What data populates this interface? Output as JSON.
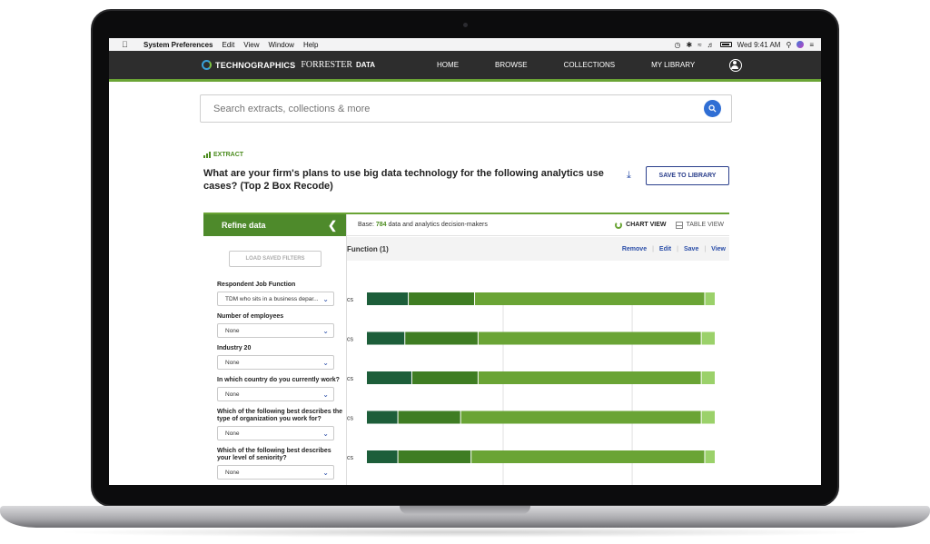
{
  "menubar": {
    "app_name": "System Preferences",
    "menus": [
      "Edit",
      "View",
      "Window",
      "Help"
    ],
    "clock": "Wed 9:41 AM"
  },
  "nav": {
    "logo_primary": "TECHNOGRAPHICS",
    "logo_secondary": "FORRESTER",
    "logo_suffix": "DATA",
    "links": [
      "HOME",
      "BROWSE",
      "COLLECTIONS",
      "MY LIBRARY"
    ]
  },
  "search": {
    "placeholder": "Search extracts, collections & more"
  },
  "extract": {
    "label": "EXTRACT",
    "question": "What are your firm's plans to use big data technology for the following analytics use cases? (Top 2 Box Recode)",
    "save_button": "SAVE TO LIBRARY"
  },
  "sidebar": {
    "title": "Refine data",
    "load_button": "LOAD SAVED FILTERS",
    "filters": [
      {
        "label": "Respondent Job Function",
        "value": "TDM who sits in a business depar..."
      },
      {
        "label": "Number of employees",
        "value": "None"
      },
      {
        "label": "Industry 20",
        "value": "None"
      },
      {
        "label": "In which country do you currently work?",
        "value": "None"
      },
      {
        "label": "Which of the following best describes the type of organization you work for?",
        "value": "None"
      },
      {
        "label": "Which of the following best describes your level of seniority?",
        "value": "None"
      }
    ]
  },
  "main": {
    "base_prefix": "Base:",
    "base_count": "784",
    "base_suffix": "data and analytics decision-makers",
    "chart_view": "CHART VIEW",
    "table_view": "TABLE VIEW",
    "filter_label": "Function (1)",
    "actions": [
      "Remove",
      "Edit",
      "Save",
      "View"
    ]
  },
  "chart_data": {
    "type": "bar",
    "orientation": "horizontal-stacked",
    "categories": [
      "cs",
      "cs",
      "cs",
      "cs",
      "cs"
    ],
    "series": [
      {
        "values": [
          12,
          11,
          13,
          9,
          9
        ],
        "color": "#1d5e3a"
      },
      {
        "values": [
          19,
          21,
          19,
          18,
          21
        ],
        "color": "#3f7d23"
      },
      {
        "values": [
          66,
          64,
          64,
          69,
          67
        ],
        "color": "#6aa435"
      },
      {
        "values": [
          3,
          4,
          4,
          4,
          3
        ],
        "color": "#9bd16a"
      }
    ],
    "xlim": [
      0,
      100
    ],
    "grid": true
  },
  "colors": {
    "brand_green": "#6aa435",
    "nav_bg": "#2d2d2d",
    "link_blue": "#2b4ea8"
  }
}
